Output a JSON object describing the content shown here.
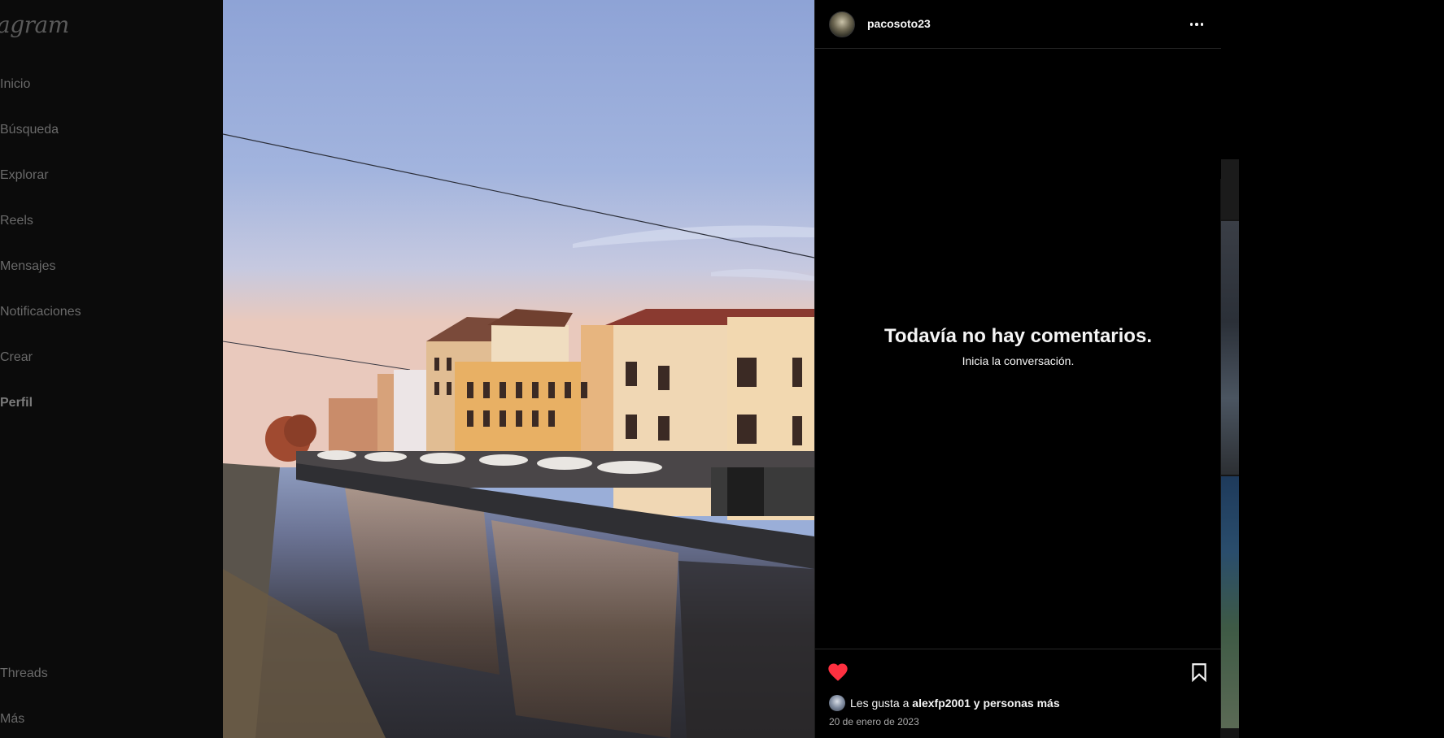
{
  "sidebar": {
    "logo": "agram",
    "items": [
      {
        "label": "Inicio"
      },
      {
        "label": "Búsqueda"
      },
      {
        "label": "Explorar"
      },
      {
        "label": "Reels"
      },
      {
        "label": "Mensajes"
      },
      {
        "label": "Notificaciones"
      },
      {
        "label": "Crear"
      },
      {
        "label": "Perfil"
      }
    ],
    "bottom_items": [
      {
        "label": "Threads"
      },
      {
        "label": "Más"
      }
    ]
  },
  "post": {
    "username": "pacosoto23",
    "more_icon": "more-horizontal-icon",
    "empty_title": "Todavía no hay comentarios.",
    "empty_subtitle": "Inicia la conversación.",
    "liked": true,
    "like_color": "#ff3040",
    "likes_prefix": "Les gusta a ",
    "likes_user": "alexfp2001",
    "likes_suffix": " y personas más",
    "date": "20 de enero de 2023"
  }
}
